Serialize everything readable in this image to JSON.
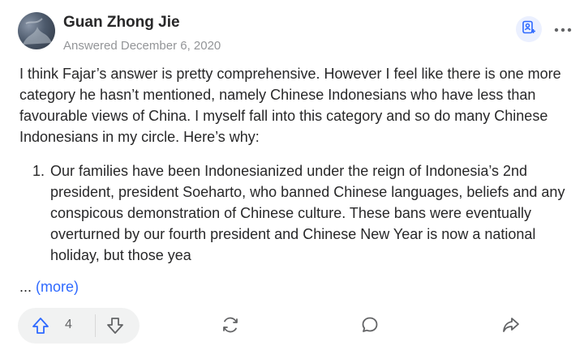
{
  "author": {
    "name": "Guan Zhong Jie",
    "answered": "Answered December 6, 2020"
  },
  "answer": {
    "intro": "I think Fajar’s answer is pretty comprehensive. However I feel like there is one more category he hasn’t mentioned, namely Chinese Indonesians who have less than favourable views of China. I myself fall into this category and so do many Chinese Indonesians in my circle. Here’s why:",
    "list_items": [
      "Our families have been Indonesianized under the reign of Indonesia’s 2nd president, president Soeharto, who banned Chinese languages, beliefs and any conspicous demonstration of Chinese culture. These bans were eventually overturned by our fourth president and Chinese New Year is now a national holiday, but those yea"
    ],
    "more_prefix": "...",
    "more_label": "(more)"
  },
  "actions": {
    "upvote_count": "4"
  },
  "icons": {
    "follow": "follow-user-icon",
    "more": "more-options-icon",
    "upvote": "upvote-arrow-icon",
    "downvote": "downvote-arrow-icon",
    "share": "share-refresh-icon",
    "comment": "comment-icon",
    "forward": "forward-share-icon"
  },
  "colors": {
    "accent": "#2e69ff",
    "text": "#282829",
    "muted": "#939598"
  }
}
